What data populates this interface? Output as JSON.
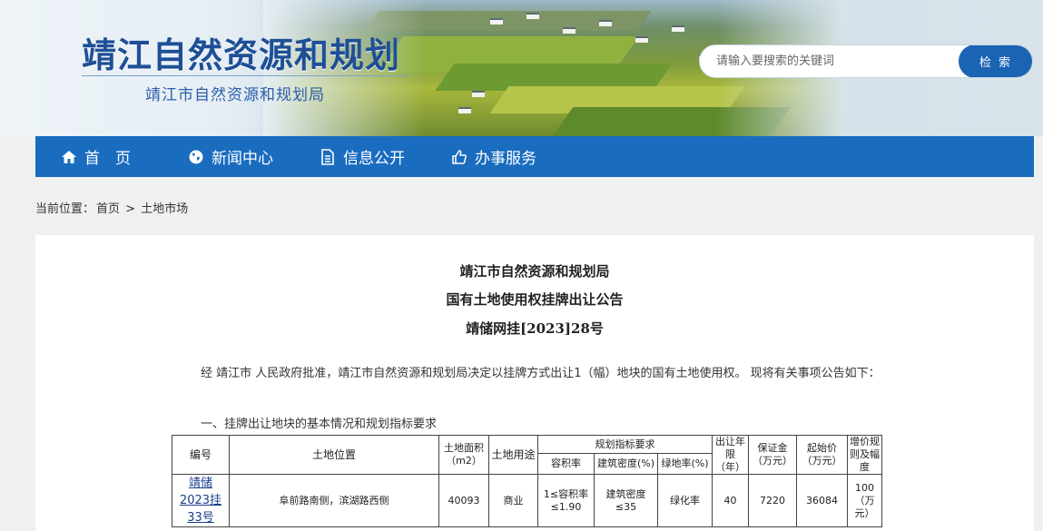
{
  "header": {
    "site_title": "靖江自然资源和规划",
    "site_subtitle": "靖江市自然资源和规划局",
    "search": {
      "placeholder": "请输入要搜索的关键词",
      "button_label": "检 索"
    }
  },
  "nav": {
    "items": [
      {
        "label": "首　页",
        "icon": "home-icon"
      },
      {
        "label": "新闻中心",
        "icon": "globe-icon"
      },
      {
        "label": "信息公开",
        "icon": "document-icon"
      },
      {
        "label": "办事服务",
        "icon": "thumbs-up-icon"
      }
    ]
  },
  "breadcrumb": {
    "prefix": "当前位置：",
    "home": "首页",
    "separator": ">",
    "current": "土地市场"
  },
  "document": {
    "title_line1": "靖江市自然资源和规划局",
    "title_line2": "国有土地使用权挂牌出让公告",
    "title_line3": "靖储网挂[2023]28号",
    "intro": "经 靖江市 人民政府批准，靖江市自然资源和规划局决定以挂牌方式出让1（幅）地块的国有土地使用权。 现将有关事项公告如下：",
    "section1_heading": "一、挂牌出让地块的基本情况和规划指标要求"
  },
  "table": {
    "headers": {
      "number": "编号",
      "location": "土地位置",
      "area": "土地面积（m2）",
      "usage": "土地用途",
      "planning": "规划指标要求",
      "far": "容积率",
      "density": "建筑密度(%)",
      "green": "绿地率(%)",
      "term": "出让年限（年）",
      "deposit": "保证金（万元）",
      "start_price": "起始价（万元）",
      "increment": "增价规则及幅度"
    },
    "rows": [
      {
        "number": "靖储2023挂33号",
        "location": "阜前路南侧，滨湖路西侧",
        "area": "40093",
        "usage": "商业",
        "far": "1≤容积率≤1.90",
        "density": "建筑密度≤35",
        "green": "绿化率",
        "term": "40",
        "deposit": "7220",
        "start_price": "36084",
        "increment": "100（万元）"
      }
    ]
  },
  "colors": {
    "nav_bg": "#1a6cbf",
    "title_blue": "#1e4f96",
    "search_button": "#1b63b3",
    "page_bg": "#f0f0f0"
  }
}
